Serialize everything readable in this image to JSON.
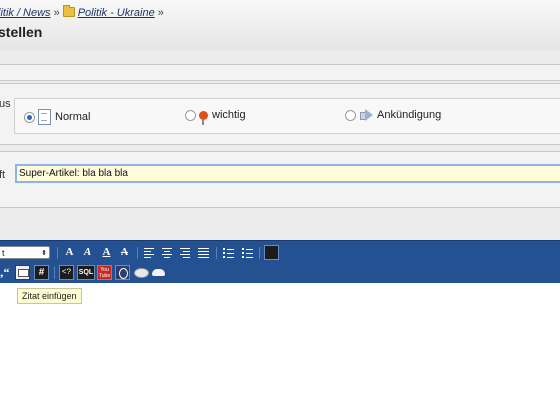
{
  "breadcrumb": {
    "parent": "litik / News",
    "separator": "»",
    "current": "Politik - Ukraine",
    "trailing": "»"
  },
  "page_title": "stellen",
  "status_row": {
    "label": "us",
    "options": [
      {
        "label": "Normal",
        "selected": true,
        "icon": "document-icon"
      },
      {
        "label": "wichtig",
        "selected": false,
        "icon": "pin-icon"
      },
      {
        "label": "Ankündigung",
        "selected": false,
        "icon": "announcement-icon"
      }
    ]
  },
  "subject_row": {
    "label": "ft",
    "value": "Super-Artikel: bla bla bla"
  },
  "toolbar": {
    "font_select_value": "t",
    "bg_color": "#245191",
    "row1_letters": [
      "A",
      "A",
      "A",
      "A"
    ],
    "quote_label": "„“",
    "hash_label": "#",
    "code_label": "<?",
    "sql_label": "SQL",
    "yt_label": "You Tube"
  },
  "tooltip": "Zitat einfügen"
}
